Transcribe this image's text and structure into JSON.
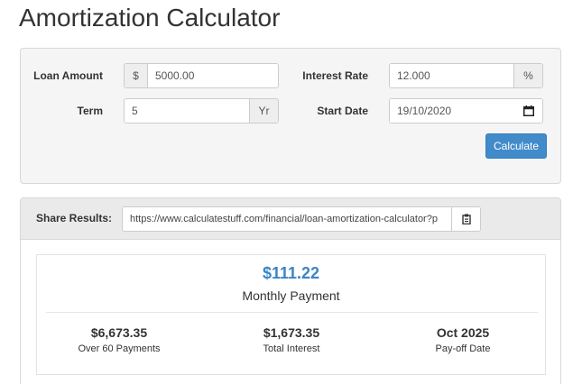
{
  "page": {
    "title": "Amortization Calculator"
  },
  "form": {
    "loan_amount": {
      "label": "Loan Amount",
      "prefix": "$",
      "value": "5000.00"
    },
    "interest_rate": {
      "label": "Interest Rate",
      "value": "12.000",
      "suffix": "%"
    },
    "term": {
      "label": "Term",
      "value": "5",
      "suffix": "Yr"
    },
    "start_date": {
      "label": "Start Date",
      "value": "19/10/2020"
    },
    "calculate_label": "Calculate"
  },
  "share": {
    "label": "Share Results:",
    "url": "https://www.calculatestuff.com/financial/loan-amortization-calculator?p"
  },
  "results": {
    "monthly_payment": "$111.22",
    "monthly_label": "Monthly Payment",
    "stats": [
      {
        "value": "$6,673.35",
        "label": "Over 60 Payments"
      },
      {
        "value": "$1,673.35",
        "label": "Total Interest"
      },
      {
        "value": "Oct 2025",
        "label": "Pay-off Date"
      }
    ]
  },
  "colors": {
    "accent": "#428bca",
    "monthly_amount": "#3c84c4",
    "panel_bg": "#f5f5f5"
  },
  "icons": {
    "date_picker": "calendar-icon",
    "copy": "clipboard-icon"
  }
}
